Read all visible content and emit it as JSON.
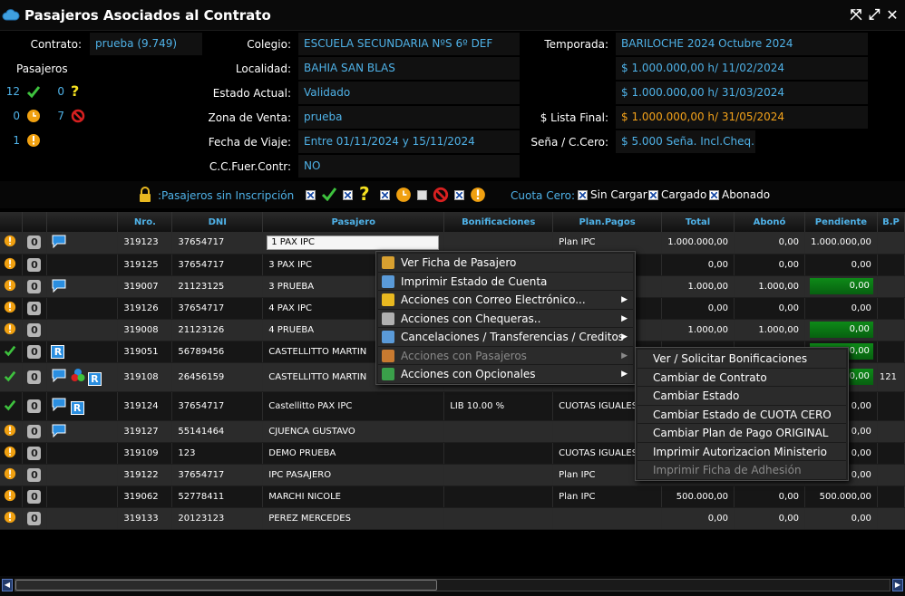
{
  "window": {
    "title": "Pasajeros Asociados al Contrato"
  },
  "info": {
    "contrato_label": "Contrato:",
    "contrato_value": "prueba (9.749)",
    "colegio_label": "Colegio:",
    "colegio_value": "ESCUELA SECUNDARIA NºS 6º DEF",
    "temporada_label": "Temporada:",
    "temporada_value": "BARILOCHE 2024 Octubre 2024",
    "localidad_label": "Localidad:",
    "localidad_value": "BAHIA SAN BLAS",
    "precio1": "$ 1.000.000,00 h/ 11/02/2024",
    "estado_label": "Estado Actual:",
    "estado_value": "Validado",
    "precio2": "$ 1.000.000,00 h/ 31/03/2024",
    "zona_label": "Zona de Venta:",
    "zona_value": "prueba",
    "lista_final_label": "$ Lista Final:",
    "lista_final_value": "$ 1.000.000,00 h/ 31/05/2024",
    "fecha_label": "Fecha de Viaje:",
    "fecha_value": "Entre 01/11/2024 y 15/11/2024",
    "sena_label": "Seña / C.Cero:",
    "sena_value": "$ 5.000 Seña. Incl.Cheq.",
    "ccfuer_label": "C.C.Fuer.Contr:",
    "ccfuer_value": "NO"
  },
  "pasajeros": {
    "title": "Pasajeros",
    "ok_count": "12",
    "pending_q_count": "0",
    "clock_count": "0",
    "cancel_count": "7",
    "alert_count": "1"
  },
  "legend": {
    "sin_inscripcion": ":Pasajeros sin Inscripción",
    "cuota_cero": "Cuota Cero:",
    "sin_cargar": "Sin Cargar",
    "cargado": "Cargado",
    "abonado": "Abonado"
  },
  "columns": [
    "",
    "",
    "",
    "Nro.",
    "DNI",
    "Pasajero",
    "Bonificaciones",
    "Plan.Pagos",
    "Total",
    "Abonó",
    "Pendiente",
    "B.P"
  ],
  "rows": [
    {
      "status": "alert",
      "zero": "0",
      "chat": true,
      "r": false,
      "multi": false,
      "nro": "319123",
      "dni": "37654717",
      "pasajero": "1 PAX IPC",
      "bonif": "",
      "plan": "Plan IPC",
      "total": "1.000.000,00",
      "abono": "0,00",
      "pendiente": "1.000.000,00",
      "green": false
    },
    {
      "status": "alert",
      "zero": "0",
      "chat": false,
      "r": false,
      "multi": false,
      "nro": "319125",
      "dni": "37654717",
      "pasajero": "3 PAX IPC",
      "bonif": "",
      "plan": "",
      "total": "0,00",
      "abono": "0,00",
      "pendiente": "0,00",
      "green": false
    },
    {
      "status": "alert",
      "zero": "0",
      "chat": true,
      "r": false,
      "multi": false,
      "nro": "319007",
      "dni": "21123125",
      "pasajero": "3 PRUEBA",
      "bonif": "",
      "plan": "",
      "total": "1.000,00",
      "abono": "1.000,00",
      "pendiente": "0,00",
      "green": true
    },
    {
      "status": "alert",
      "zero": "0",
      "chat": false,
      "r": false,
      "multi": false,
      "nro": "319126",
      "dni": "37654717",
      "pasajero": "4 PAX IPC",
      "bonif": "",
      "plan": "",
      "total": "0,00",
      "abono": "0,00",
      "pendiente": "0,00",
      "green": false
    },
    {
      "status": "alert",
      "zero": "0",
      "chat": false,
      "r": false,
      "multi": false,
      "nro": "319008",
      "dni": "21123126",
      "pasajero": "4 PRUEBA",
      "bonif": "",
      "plan": "",
      "total": "1.000,00",
      "abono": "1.000,00",
      "pendiente": "0,00",
      "green": true
    },
    {
      "status": "ok",
      "zero": "0",
      "chat": false,
      "r": true,
      "multi": false,
      "nro": "319051",
      "dni": "56789456",
      "pasajero": "CASTELLITTO MARTIN",
      "bonif": "",
      "plan": "",
      "total": "",
      "abono": "",
      "pendiente": "0,00",
      "green": true
    },
    {
      "status": "ok",
      "zero": "0",
      "chat": true,
      "r": true,
      "multi": true,
      "nro": "319108",
      "dni": "26456159",
      "pasajero": "CASTELLITTO MARTIN",
      "bonif": "",
      "plan": "",
      "total": "",
      "abono": "",
      "pendiente": "0,00",
      "green": true,
      "tall": true,
      "extra": "121"
    },
    {
      "status": "ok",
      "zero": "0",
      "chat": true,
      "r": true,
      "multi": false,
      "nro": "319124",
      "dni": "37654717",
      "pasajero": "Castellitto PAX IPC",
      "bonif": "LIB 10.00 %",
      "plan": "CUOTAS IGUALES",
      "total": "",
      "abono": "",
      "pendiente": "0,00",
      "green": false,
      "tall": true
    },
    {
      "status": "alert",
      "zero": "0",
      "chat": true,
      "r": false,
      "multi": false,
      "nro": "319127",
      "dni": "55141464",
      "pasajero": "CJUENCA GUSTAVO",
      "bonif": "",
      "plan": "",
      "total": "",
      "abono": "",
      "pendiente": "0,00",
      "green": false
    },
    {
      "status": "alert",
      "zero": "0",
      "chat": false,
      "r": false,
      "multi": false,
      "nro": "319109",
      "dni": "123",
      "pasajero": "DEMO PRUEBA",
      "bonif": "",
      "plan": "CUOTAS IGUALES",
      "total": "",
      "abono": "",
      "pendiente": "0,00",
      "green": false
    },
    {
      "status": "alert",
      "zero": "0",
      "chat": false,
      "r": false,
      "multi": false,
      "nro": "319122",
      "dni": "37654717",
      "pasajero": "IPC PASAJERO",
      "bonif": "",
      "plan": "Plan IPC",
      "total": "",
      "abono": "",
      "pendiente": "0,00",
      "green": false
    },
    {
      "status": "alert",
      "zero": "0",
      "chat": false,
      "r": false,
      "multi": false,
      "nro": "319062",
      "dni": "52778411",
      "pasajero": "MARCHI NICOLE",
      "bonif": "",
      "plan": "Plan IPC",
      "total": "500.000,00",
      "abono": "0,00",
      "pendiente": "500.000,00",
      "green": false
    },
    {
      "status": "alert",
      "zero": "0",
      "chat": false,
      "r": false,
      "multi": false,
      "nro": "319133",
      "dni": "20123123",
      "pasajero": "PEREZ MERCEDES",
      "bonif": "",
      "plan": "",
      "total": "0,00",
      "abono": "0,00",
      "pendiente": "0,00",
      "green": false
    }
  ],
  "context_menu": {
    "items": [
      {
        "label": "Ver Ficha de Pasajero",
        "icon": "file-icon",
        "color": "#d8a030",
        "sub": false,
        "disabled": false
      },
      {
        "label": "Imprimir Estado de Cuenta",
        "icon": "print-icon",
        "color": "#5a9ad8",
        "sub": false,
        "disabled": false
      },
      {
        "label": "Acciones con Correo Electrónico...",
        "icon": "mail-icon",
        "color": "#e8b820",
        "sub": true,
        "disabled": false
      },
      {
        "label": "Acciones con Chequeras..",
        "icon": "checkbook-icon",
        "color": "#b0b0b0",
        "sub": true,
        "disabled": false
      },
      {
        "label": "Cancelaciones / Transferencias / Creditos",
        "icon": "transfer-icon",
        "color": "#5a9ad8",
        "sub": true,
        "disabled": false
      },
      {
        "label": "Acciones con Pasajeros",
        "icon": "users-icon",
        "color": "#c87a30",
        "sub": true,
        "disabled": true
      },
      {
        "label": "Acciones con Opcionales",
        "icon": "options-icon",
        "color": "#3aa04a",
        "sub": true,
        "disabled": false
      }
    ]
  },
  "submenu": {
    "items": [
      {
        "label": "Ver / Solicitar Bonificaciones",
        "disabled": false
      },
      {
        "label": "Cambiar de Contrato",
        "disabled": false
      },
      {
        "label": "Cambiar Estado",
        "disabled": false
      },
      {
        "label": "Cambiar Estado de CUOTA CERO",
        "disabled": false
      },
      {
        "label": "Cambiar Plan de Pago ORIGINAL",
        "disabled": false
      },
      {
        "label": "Imprimir Autorizacion Ministerio",
        "disabled": false
      },
      {
        "label": "Imprimir Ficha de Adhesión",
        "disabled": true
      }
    ]
  },
  "colors": {
    "accent": "#4fb2e8",
    "orange": "#f4a21a",
    "ok": "#3ec23e",
    "alert": "#f0a010",
    "cancel": "#d82020"
  }
}
